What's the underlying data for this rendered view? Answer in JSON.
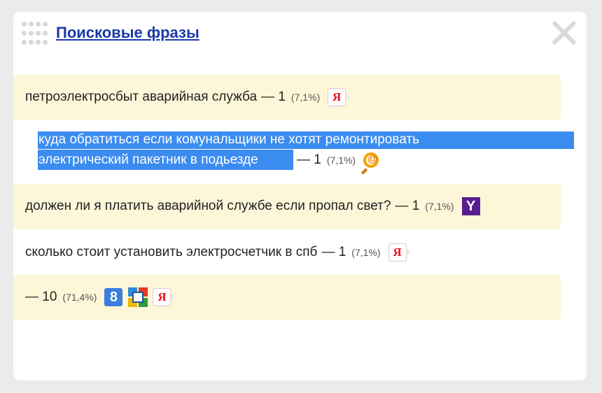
{
  "header": {
    "title": "Поисковые фразы"
  },
  "rows": [
    {
      "phrase": "петроэлектросбыт аварийная служба",
      "suffix": "— 1",
      "percent": "(7,1%)"
    },
    {
      "phrase_line1": "куда обратиться если комунальщики не хотят ремонтировать",
      "phrase_line2": "электрический пакетник в подьезде",
      "suffix": "— 1",
      "percent": "(7,1%)"
    },
    {
      "phrase": "должен ли я платить аварийной службе если пропал свет?",
      "suffix": "— 1",
      "percent": "(7,1%)"
    },
    {
      "phrase": "сколько стоит установить электросчетчик в спб",
      "suffix": "— 1",
      "percent": "(7,1%)"
    },
    {
      "phrase": "",
      "suffix": "— 10",
      "percent": "(71,4%)"
    }
  ],
  "icons": {
    "yandex": "Я",
    "yahoo": "Y",
    "google": "8"
  },
  "colors": {
    "title": "#1a3aa8",
    "row_highlight": "#fdf6d8",
    "selection": "#3b8cf0"
  }
}
